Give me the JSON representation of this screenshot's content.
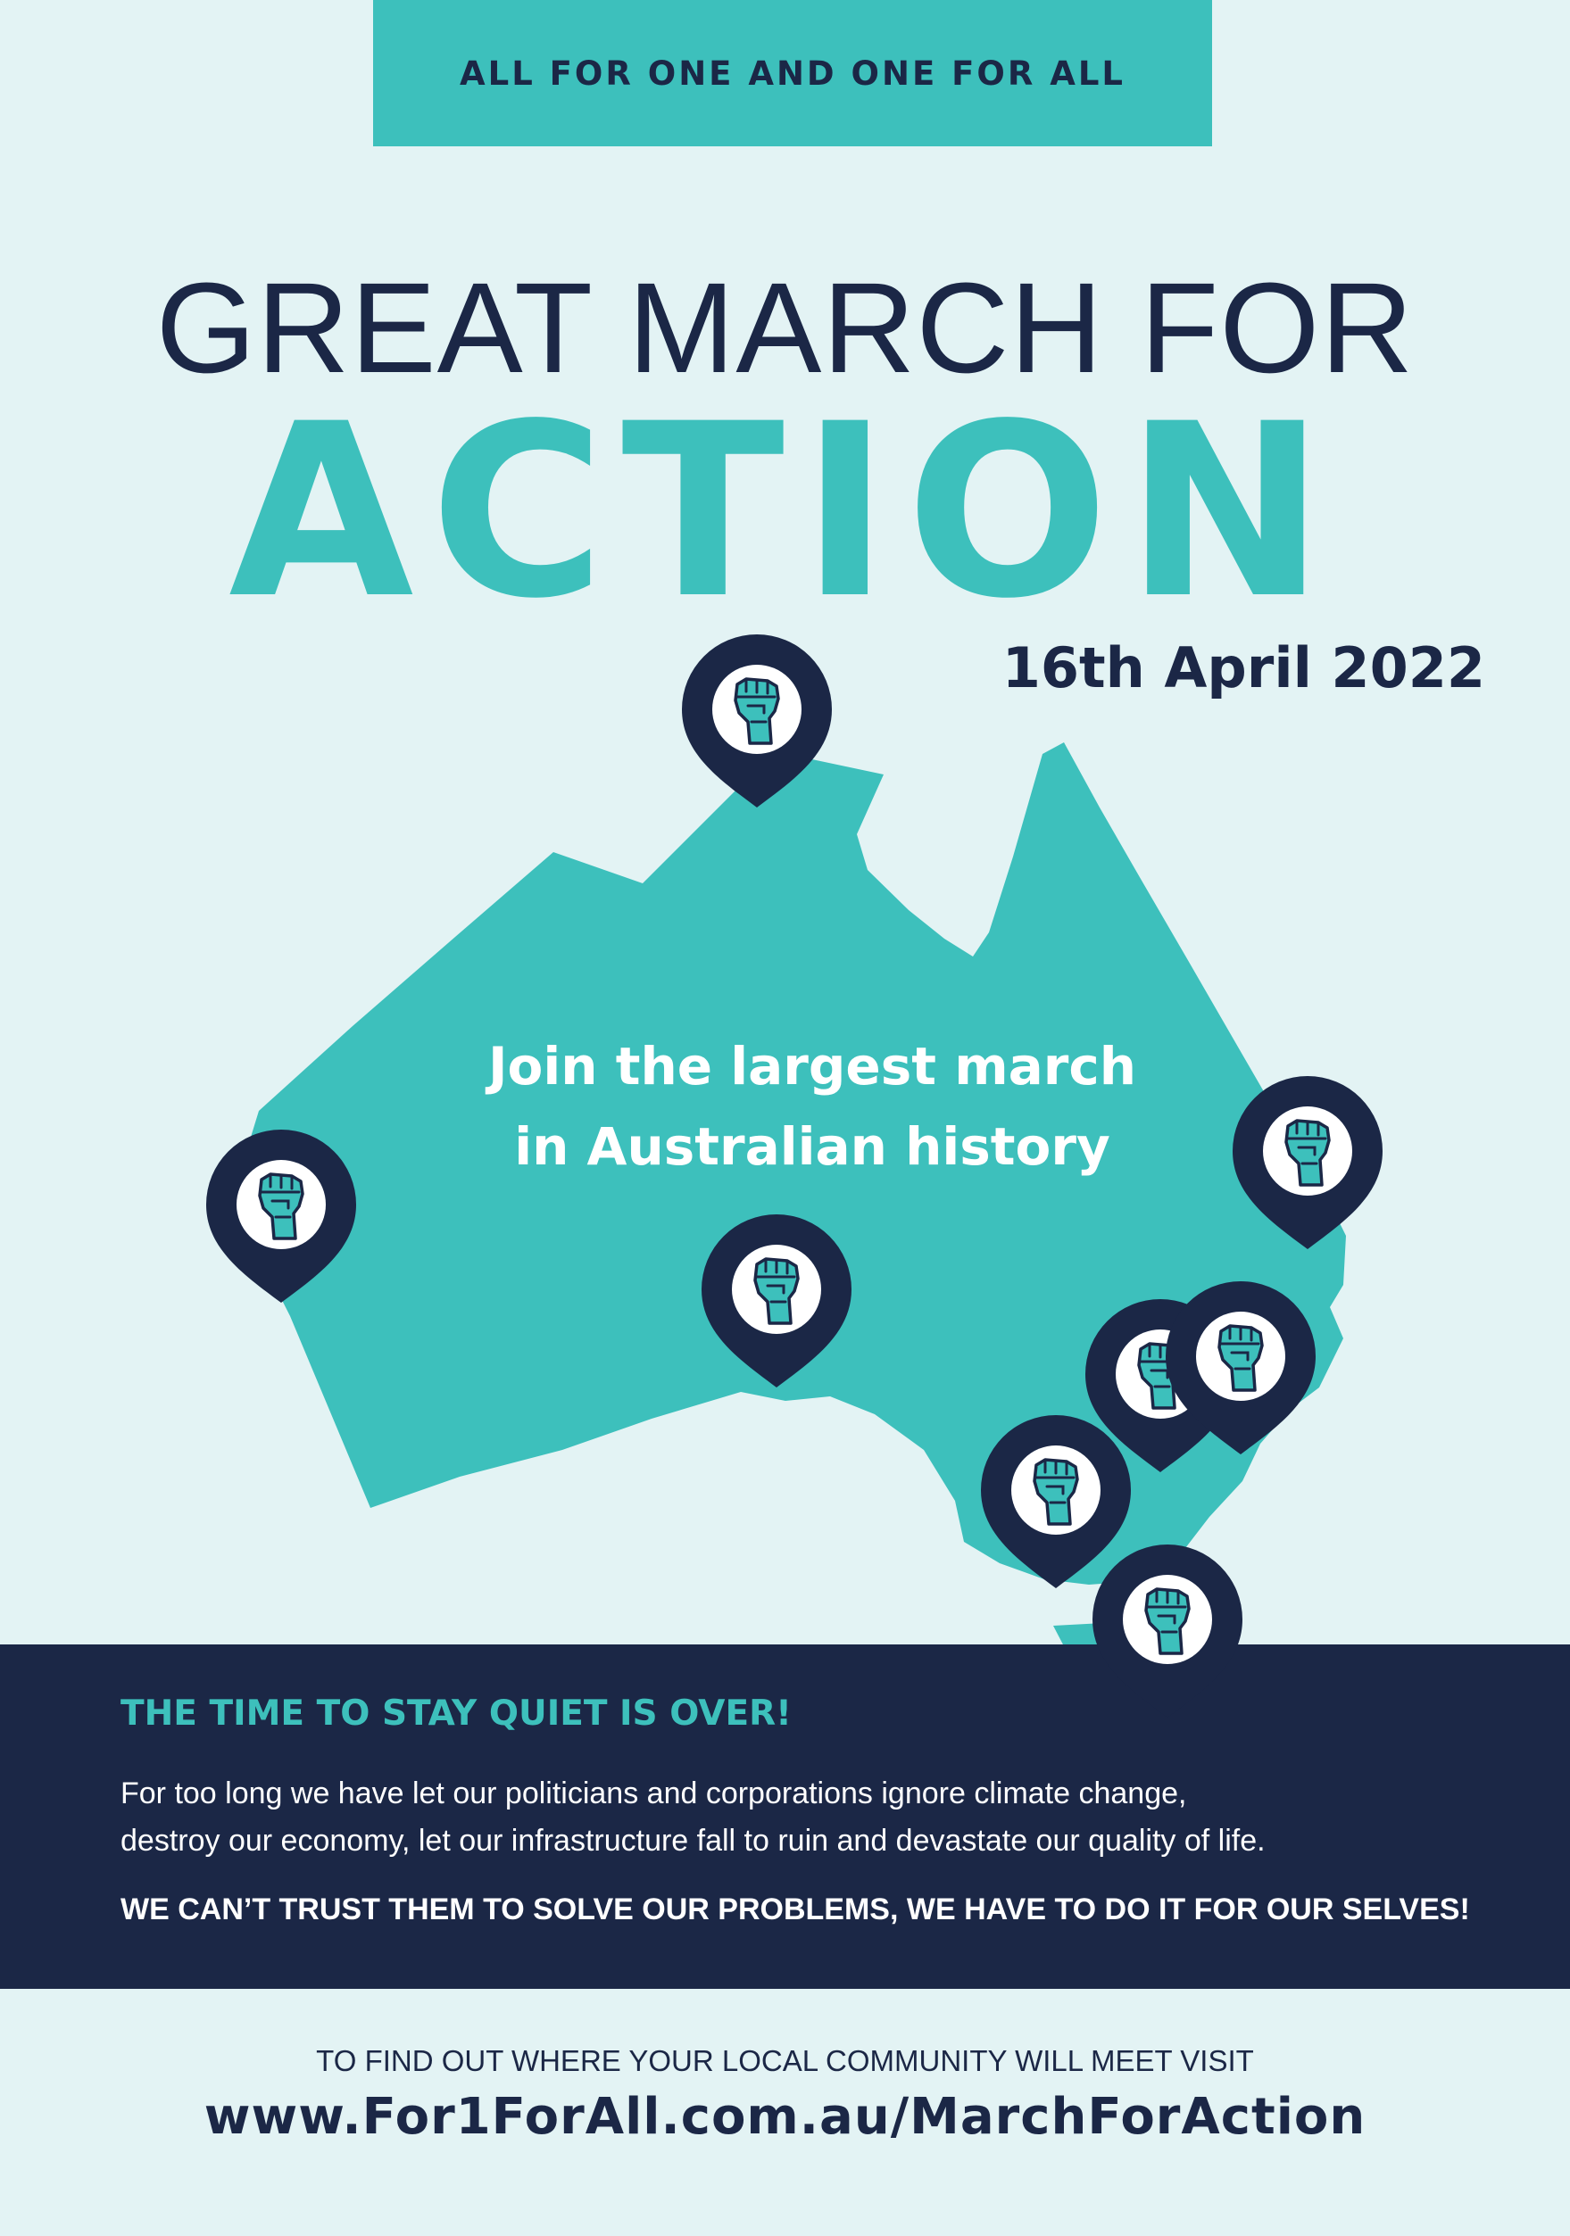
{
  "banner": {
    "tagline": "ALL FOR ONE AND ONE FOR ALL"
  },
  "headline": {
    "line1": "GREAT MARCH FOR",
    "line2": "ACTION",
    "date": "16th April 2022"
  },
  "map": {
    "caption_line1": "Join the largest march",
    "caption_line2": "in Australian history",
    "region": "Australia",
    "marker_icon": "raised-fist-icon",
    "marker_count": 8,
    "colors": {
      "land": "#3dc0bc",
      "marker": "#1b2746",
      "marker_inner": "#ffffff"
    }
  },
  "info": {
    "heading": "THE TIME TO STAY QUIET IS OVER!",
    "body_line1": "For too long we have let our politicians and corporations ignore climate change,",
    "body_line2": "destroy our economy, let our infrastructure fall to ruin and devastate our quality of life.",
    "callout": "WE CAN’T TRUST THEM TO SOLVE OUR PROBLEMS, WE HAVE TO DO IT FOR OUR SELVES!"
  },
  "footer": {
    "instruction": "TO FIND OUT WHERE YOUR LOCAL COMMUNITY WILL MEET VISIT",
    "url": "www.For1ForAll.com.au/MarchForAction"
  },
  "colors": {
    "background": "#e3f3f4",
    "accent": "#3dc0bc",
    "navy": "#1b2746",
    "white": "#ffffff"
  }
}
